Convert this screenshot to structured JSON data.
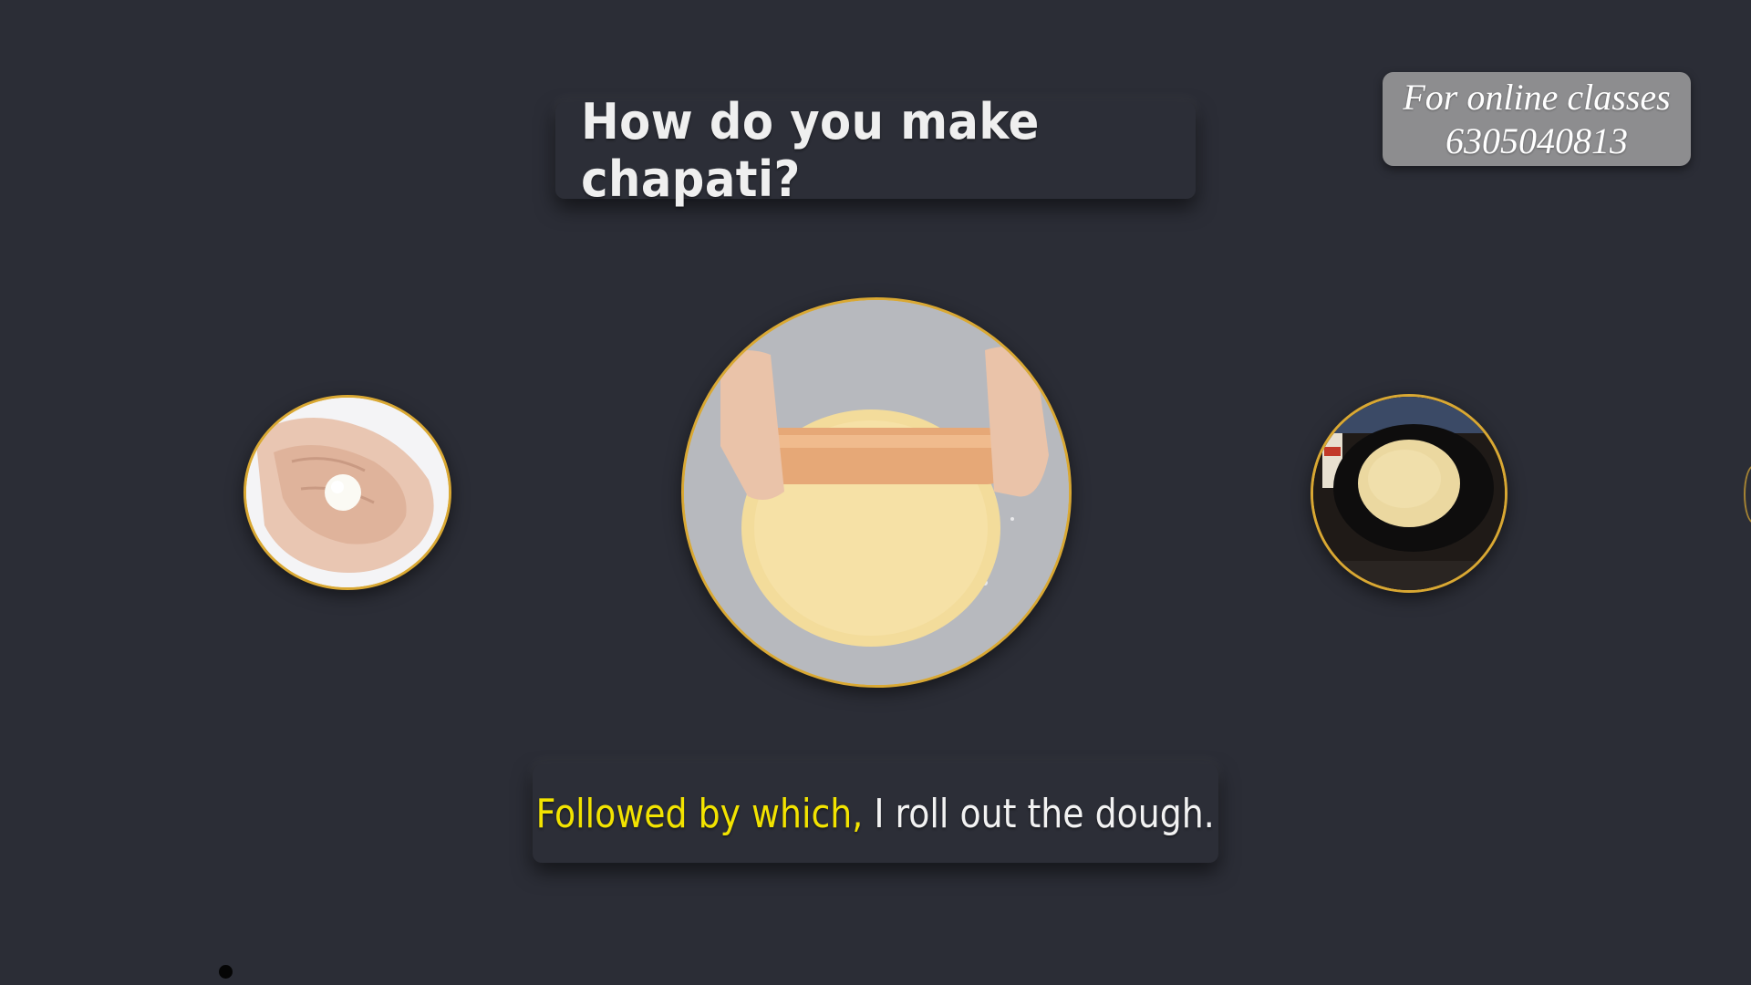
{
  "title": "How do you make chapati?",
  "promo": {
    "line1": "For online classes",
    "line2": "6305040813"
  },
  "steps": [
    {
      "image": "dough-ball-in-hand"
    },
    {
      "image": "rolling-pin-rolling-dough"
    },
    {
      "image": "chapati-on-tawa"
    }
  ],
  "caption": {
    "highlight": "Followed by which,",
    "rest": " I roll out the dough."
  },
  "colors": {
    "background": "#2b2d36",
    "circle_border": "#d9a833",
    "caption_highlight": "#f2e300"
  }
}
